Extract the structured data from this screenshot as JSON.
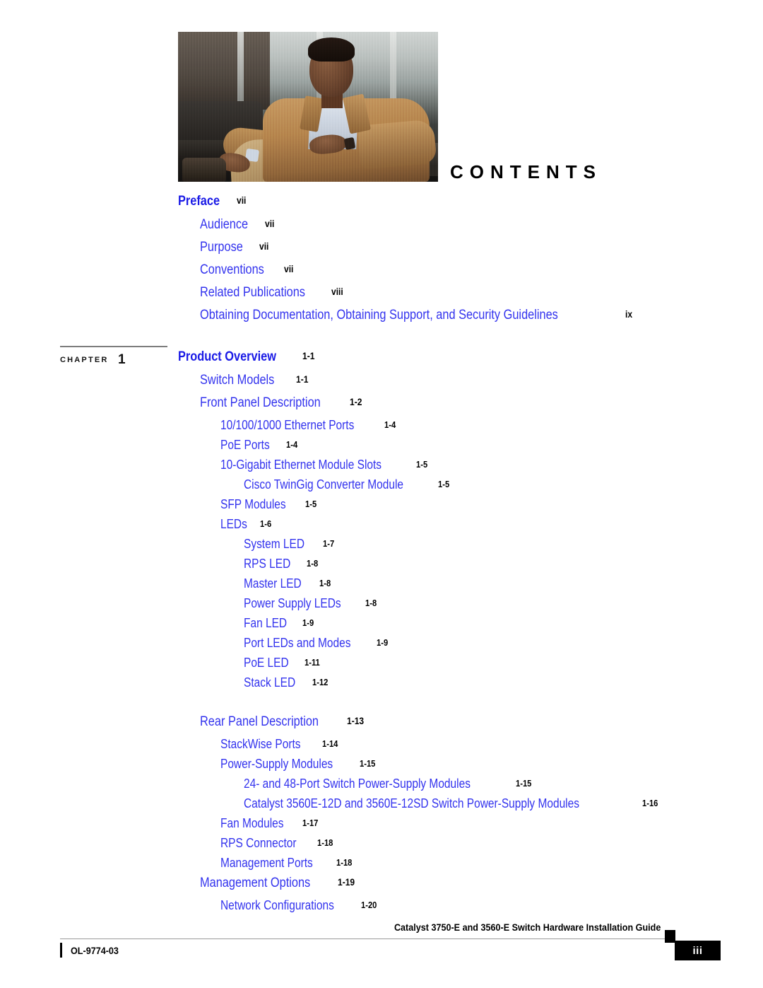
{
  "page": {
    "heading": "CONTENTS",
    "photo_alt": "seated-man-photo"
  },
  "chapter_marker": {
    "word": "CHAPTER",
    "number": "1"
  },
  "toc": [
    {
      "level": 1,
      "title": "Preface",
      "page": "vii",
      "gap": false
    },
    {
      "level": 2,
      "title": "Audience",
      "page": "vii",
      "gap": false
    },
    {
      "level": 2,
      "title": "Purpose",
      "page": "vii",
      "gap": false
    },
    {
      "level": 2,
      "title": "Conventions",
      "page": "vii",
      "gap": false
    },
    {
      "level": 2,
      "title": "Related Publications",
      "page": "viii",
      "gap": false
    },
    {
      "level": 2,
      "title": "Obtaining Documentation, Obtaining Support, and Security Guidelines",
      "page": "ix",
      "gap": false
    },
    {
      "level": 1,
      "title": "Product Overview",
      "page": "1-1",
      "gap": true
    },
    {
      "level": 2,
      "title": "Switch Models",
      "page": "1-1",
      "gap": false
    },
    {
      "level": 2,
      "title": "Front Panel Description",
      "page": "1-2",
      "gap": false
    },
    {
      "level": 3,
      "title": "10/100/1000 Ethernet Ports",
      "page": "1-4",
      "gap": false
    },
    {
      "level": 3,
      "title": "PoE Ports",
      "page": "1-4",
      "gap": false
    },
    {
      "level": 3,
      "title": "10-Gigabit Ethernet Module Slots",
      "page": "1-5",
      "gap": false
    },
    {
      "level": 4,
      "title": "Cisco TwinGig Converter Module",
      "page": "1-5",
      "gap": false
    },
    {
      "level": 3,
      "title": "SFP Modules",
      "page": "1-5",
      "gap": false
    },
    {
      "level": 3,
      "title": "LEDs",
      "page": "1-6",
      "gap": false
    },
    {
      "level": 4,
      "title": "System LED",
      "page": "1-7",
      "gap": false
    },
    {
      "level": 4,
      "title": "RPS LED",
      "page": "1-8",
      "gap": false
    },
    {
      "level": 4,
      "title": "Master LED",
      "page": "1-8",
      "gap": false
    },
    {
      "level": 4,
      "title": "Power Supply LEDs",
      "page": "1-8",
      "gap": false
    },
    {
      "level": 4,
      "title": "Fan LED",
      "page": "1-9",
      "gap": false
    },
    {
      "level": 4,
      "title": "Port LEDs and Modes",
      "page": "1-9",
      "gap": false
    },
    {
      "level": 4,
      "title": "PoE LED",
      "page": "1-11",
      "gap": false
    },
    {
      "level": 4,
      "title": "Stack LED",
      "page": "1-12",
      "gap": false
    },
    {
      "level": 2,
      "title": "Rear Panel Description",
      "page": "1-13",
      "gap": true
    },
    {
      "level": 3,
      "title": "StackWise Ports",
      "page": "1-14",
      "gap": false
    },
    {
      "level": 3,
      "title": "Power-Supply Modules",
      "page": "1-15",
      "gap": false
    },
    {
      "level": 4,
      "title": "24- and 48-Port Switch Power-Supply Modules",
      "page": "1-15",
      "gap": false
    },
    {
      "level": 4,
      "title": "Catalyst 3560E-12D and 3560E-12SD Switch Power-Supply Modules",
      "page": "1-16",
      "gap": false
    },
    {
      "level": 3,
      "title": "Fan Modules",
      "page": "1-17",
      "gap": false
    },
    {
      "level": 3,
      "title": "RPS Connector",
      "page": "1-18",
      "gap": false
    },
    {
      "level": 3,
      "title": "Management Ports",
      "page": "1-18",
      "gap": false
    },
    {
      "level": 2,
      "title": "Management Options",
      "page": "1-19",
      "gap": false
    },
    {
      "level": 3,
      "title": "Network Configurations",
      "page": "1-20",
      "gap": false
    }
  ],
  "footer": {
    "title": "Catalyst 3750-E and 3560-E Switch Hardware Installation Guide",
    "doc_number": "OL-9774-03",
    "page_number": "iii"
  },
  "colors": {
    "heading_black": "#000000",
    "level1_blue": "#1a1ae6",
    "sub_blue": "#3333ee",
    "rule_gray": "#7d7d7d",
    "footer_rule": "#9a9a9a"
  }
}
